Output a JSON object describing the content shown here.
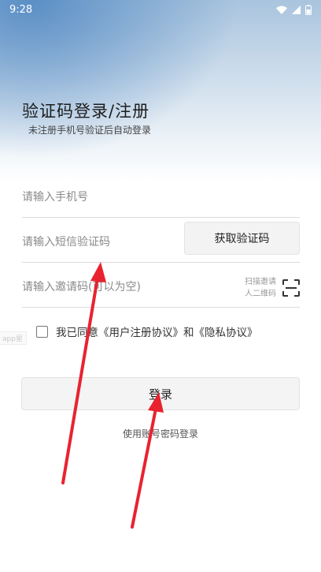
{
  "status_bar": {
    "time": "9:28"
  },
  "header": {
    "title": "验证码登录/注册",
    "subtitle": "未注册手机号验证后自动登录"
  },
  "form": {
    "phone_placeholder": "请输入手机号",
    "sms_placeholder": "请输入短信验证码",
    "sms_button_label": "获取验证码",
    "invite_placeholder": "请输入邀请码(可以为空)",
    "scan_label_line1": "扫描邀请",
    "scan_label_line2": "人二维码"
  },
  "agreement": {
    "prefix": "我已同意",
    "user_agreement": "《用户注册协议》",
    "conjunction": "和",
    "privacy_agreement": "《隐私协议》",
    "checked": false
  },
  "watermark_text": "app星",
  "actions": {
    "login_label": "登录",
    "password_login_label": "使用账号密码登录"
  },
  "colors": {
    "annotation_arrow": "#e8232f",
    "header_gradient": "#5b8fc6"
  }
}
